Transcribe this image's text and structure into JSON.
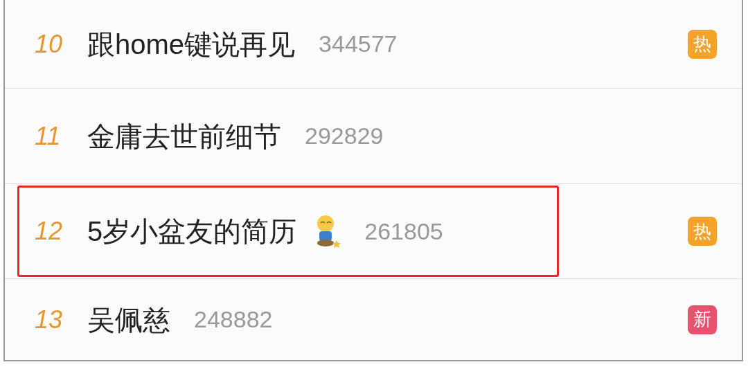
{
  "rows": [
    {
      "rank": "10",
      "title": "跟home键说再见",
      "count": "344577",
      "emoji": false,
      "highlighted": false,
      "badge": {
        "label": "热",
        "color": "#f3a32a"
      }
    },
    {
      "rank": "11",
      "title": "金庸去世前细节",
      "count": "292829",
      "emoji": false,
      "highlighted": false
    },
    {
      "rank": "12",
      "title": "5岁小盆友的简历",
      "count": "261805",
      "emoji": true,
      "highlighted": true,
      "badge": {
        "label": "热",
        "color": "#f3a32a"
      }
    },
    {
      "rank": "13",
      "title": "吴佩慈",
      "count": "248882",
      "emoji": false,
      "highlighted": false,
      "badge": {
        "label": "新",
        "color": "#e9526f"
      }
    }
  ]
}
